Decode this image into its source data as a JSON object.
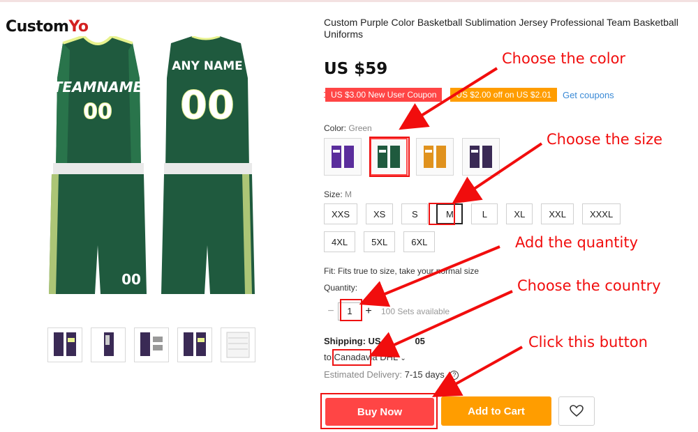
{
  "brand": {
    "name_part1": "Custom",
    "name_part2": "Yo"
  },
  "product": {
    "title": "Custom Purple Color Basketball Sublimation Jersey Professional Team Basketball Uniforms",
    "price": "US $59",
    "jersey_front": {
      "team": "TEAMNAME",
      "number": "00"
    },
    "jersey_back": {
      "name": "ANY NAME",
      "number": "00"
    },
    "shorts_number": "00"
  },
  "coupons": {
    "new_user": "US $3.00 New User Coupon",
    "store": "US $2.00 off on US $2.01",
    "get_link": "Get coupons"
  },
  "color": {
    "label": "Color:",
    "selected": "Green",
    "options": [
      {
        "name": "purple",
        "hex": "#5a2d9c",
        "selected": false
      },
      {
        "name": "green",
        "hex": "#1f5a3e",
        "selected": true
      },
      {
        "name": "orange",
        "hex": "#e0921e",
        "selected": false
      },
      {
        "name": "dark-purple",
        "hex": "#3a2a55",
        "selected": false
      }
    ]
  },
  "size": {
    "label": "Size:",
    "selected": "M",
    "options": [
      "XXS",
      "XS",
      "S",
      "M",
      "L",
      "XL",
      "XXL",
      "XXXL",
      "4XL",
      "5XL",
      "6XL"
    ]
  },
  "fit": "Fit: Fits true to size, take your normal size",
  "quantity": {
    "label": "Quantity:",
    "value": "1",
    "minus": "−",
    "plus": "+",
    "available": "100 Sets available"
  },
  "shipping": {
    "title": "Shipping: US $",
    "title_tail": "05",
    "to": "to",
    "country": "Canada",
    "via": "via DHL",
    "delivery_label": "Estimated Delivery:",
    "delivery_value": "7-15 days",
    "help": "?"
  },
  "actions": {
    "buy_now": "Buy Now",
    "add_to_cart": "Add to Cart",
    "wishlist_icon": "heart-icon"
  },
  "annotations": {
    "color": "Choose the color",
    "size": "Choose the size",
    "quantity": "Add the quantity",
    "country": "Choose the country",
    "button": "Click this button"
  },
  "colors": {
    "accent_red": "#ff4545",
    "accent_orange": "#ff9d00",
    "link_blue": "#3a8ad6",
    "annotation_red": "#f10d0d",
    "jersey_green": "#1f5a3e"
  }
}
